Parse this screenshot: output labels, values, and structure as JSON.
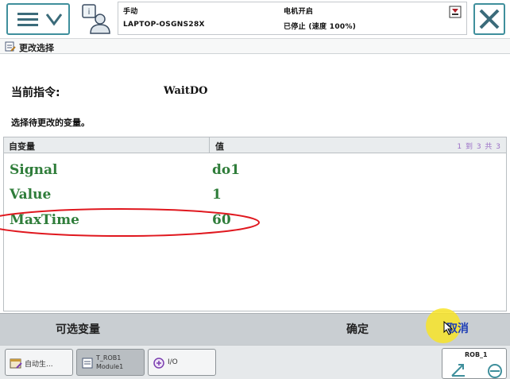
{
  "status": {
    "mode_label": "手动",
    "system_name": "LAPTOP-OSGNS28X",
    "motors_label": "电机开启",
    "state_text": "已停止 (速度 100%)"
  },
  "window": {
    "title": "更改选择"
  },
  "instruction": {
    "current_label": "当前指令:",
    "current_value": "WaitDO",
    "select_prompt": "选择待更改的变量。"
  },
  "table": {
    "headers": {
      "name": "自变量",
      "value": "值"
    },
    "pager": "1 到 3 共 3",
    "rows": [
      {
        "name": "Signal",
        "value": "do1"
      },
      {
        "name": "Value",
        "value": "1"
      },
      {
        "name": "MaxTime",
        "value": "60"
      }
    ]
  },
  "actions": {
    "optional_label": "可选变量",
    "ok_label": "确定",
    "cancel_label": "取消"
  },
  "taskbar": {
    "items": [
      {
        "label": "自动生..."
      },
      {
        "label_line1": "T_ROB1",
        "label_line2": "Module1"
      },
      {
        "label": "I/O"
      }
    ],
    "quickset_label": "ROB_1"
  },
  "icons": {
    "menu": "hamburger-menu-icon",
    "chevron": "chevron-down-icon",
    "operator": "operator-info-icon",
    "status": "status-flag-icon",
    "close": "close-icon",
    "window": "window-edit-icon",
    "cursor": "mouse-cursor-icon",
    "joystick": "jog-axes-icon"
  },
  "colors": {
    "accent": "#3f8f9c",
    "row_text": "#2f7d3a",
    "highlight_ellipse": "#e0181f",
    "cursor_halo": "#f8e428"
  }
}
